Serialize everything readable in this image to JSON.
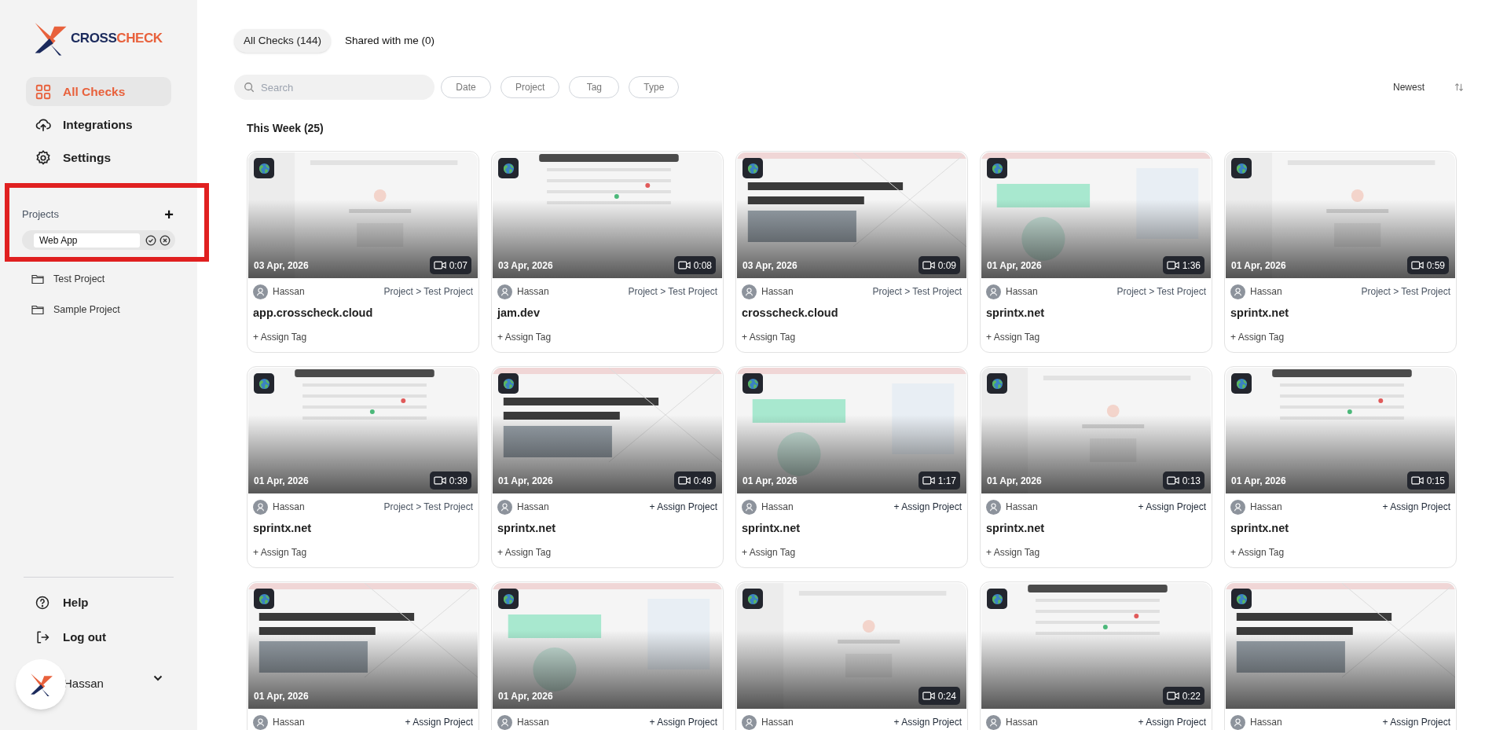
{
  "logo": {
    "text_a": "CROSS",
    "text_b": "CHECK"
  },
  "nav": [
    {
      "label": "All Checks",
      "selected": true
    },
    {
      "label": "Integrations",
      "selected": false
    },
    {
      "label": "Settings",
      "selected": false
    }
  ],
  "projects": {
    "heading": "Projects",
    "add": "+",
    "highlighted": true,
    "editing": {
      "value": "Web App"
    },
    "items": [
      {
        "label": "Test Project"
      },
      {
        "label": "Sample Project"
      }
    ]
  },
  "footer_nav": [
    {
      "label": "Help"
    },
    {
      "label": "Log out"
    }
  ],
  "user": {
    "name": "Hassan"
  },
  "tabs": [
    {
      "label": "All Checks (144)",
      "selected": true
    },
    {
      "label": "Shared with me (0)",
      "selected": false
    }
  ],
  "search": {
    "placeholder": "Search"
  },
  "filters": [
    "Date",
    "Project",
    "Tag",
    "Type"
  ],
  "sort": {
    "label": "Newest"
  },
  "section": {
    "title": "This Week (25)"
  },
  "cards": [
    {
      "date": "03 Apr, 2026",
      "duration": "0:07",
      "author": "Hassan",
      "project": {
        "kind": "path",
        "text": "Project > Test Project"
      },
      "title": "app.crosscheck.cloud",
      "tag": "+ Assign Tag"
    },
    {
      "date": "03 Apr, 2026",
      "duration": "0:08",
      "author": "Hassan",
      "project": {
        "kind": "path",
        "text": "Project > Test Project"
      },
      "title": "jam.dev",
      "tag": "+ Assign Tag"
    },
    {
      "date": "03 Apr, 2026",
      "duration": "0:09",
      "author": "Hassan",
      "project": {
        "kind": "path",
        "text": "Project > Test Project"
      },
      "title": "crosscheck.cloud",
      "tag": "+ Assign Tag"
    },
    {
      "date": "01 Apr, 2026",
      "duration": "1:36",
      "author": "Hassan",
      "project": {
        "kind": "path",
        "text": "Project > Test Project"
      },
      "title": "sprintx.net",
      "tag": "+ Assign Tag"
    },
    {
      "date": "01 Apr, 2026",
      "duration": "0:59",
      "author": "Hassan",
      "project": {
        "kind": "path",
        "text": "Project > Test Project"
      },
      "title": "sprintx.net",
      "tag": "+ Assign Tag"
    },
    {
      "date": "01 Apr, 2026",
      "duration": "0:39",
      "author": "Hassan",
      "project": {
        "kind": "path",
        "text": "Project > Test Project"
      },
      "title": "sprintx.net",
      "tag": "+ Assign Tag"
    },
    {
      "date": "01 Apr, 2026",
      "duration": "0:49",
      "author": "Hassan",
      "project": {
        "kind": "assign",
        "text": "+ Assign Project"
      },
      "title": "sprintx.net",
      "tag": "+ Assign Tag"
    },
    {
      "date": "01 Apr, 2026",
      "duration": "1:17",
      "author": "Hassan",
      "project": {
        "kind": "assign",
        "text": "+ Assign Project"
      },
      "title": "sprintx.net",
      "tag": "+ Assign Tag"
    },
    {
      "date": "01 Apr, 2026",
      "duration": "0:13",
      "author": "Hassan",
      "project": {
        "kind": "assign",
        "text": "+ Assign Project"
      },
      "title": "sprintx.net",
      "tag": "+ Assign Tag"
    },
    {
      "date": "01 Apr, 2026",
      "duration": "0:15",
      "author": "Hassan",
      "project": {
        "kind": "assign",
        "text": "+ Assign Project"
      },
      "title": "sprintx.net",
      "tag": "+ Assign Tag"
    },
    {
      "date": "01 Apr, 2026",
      "author": "Hassan",
      "project": {
        "kind": "assign",
        "text": "+ Assign Project"
      }
    },
    {
      "date": "01 Apr, 2026",
      "author": "Hassan",
      "project": {
        "kind": "assign",
        "text": "+ Assign Project"
      }
    },
    {
      "duration": "0:24",
      "author": "Hassan",
      "project": {
        "kind": "assign",
        "text": "+ Assign Project"
      }
    },
    {
      "duration": "0:22",
      "author": "Hassan",
      "project": {
        "kind": "assign",
        "text": "+ Assign Project"
      }
    },
    {
      "author": "Hassan",
      "project": {
        "kind": "assign",
        "text": "+ Assign Project"
      }
    }
  ]
}
